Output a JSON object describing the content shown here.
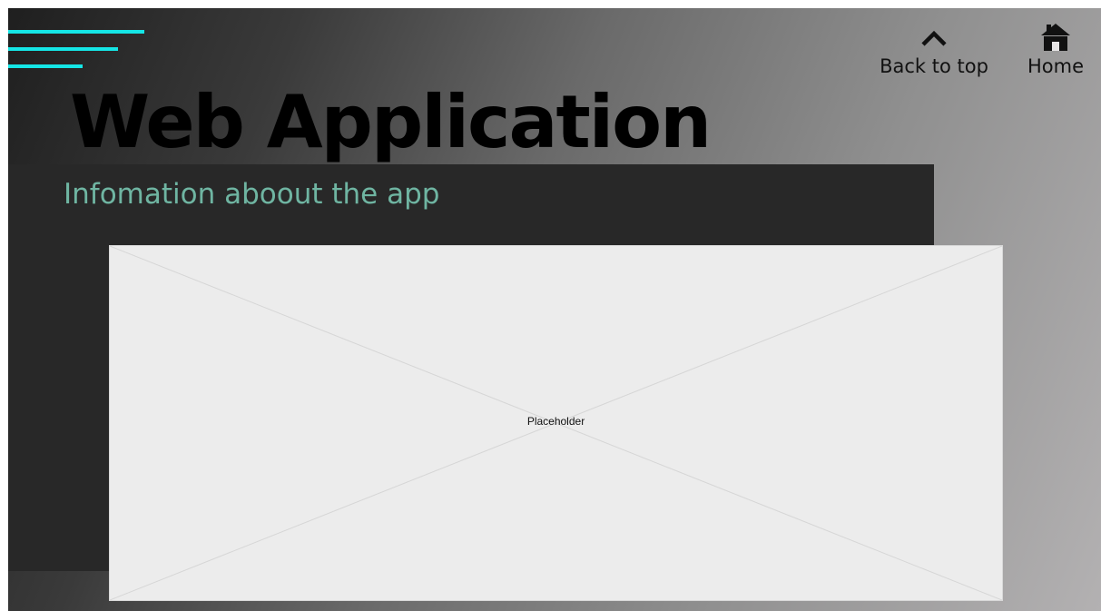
{
  "header": {
    "menu_icon": "hamburger-menu-icon",
    "accent_color": "#15e6e6"
  },
  "nav": {
    "back_to_top": {
      "label": "Back to top",
      "icon": "chevron-up-icon"
    },
    "home": {
      "label": "Home",
      "icon": "house-icon"
    }
  },
  "hero": {
    "title": "Web Application",
    "subtitle": "Infomation aboout the app",
    "subtitle_color": "#6fb5a2"
  },
  "media": {
    "placeholder_label": "Placeholder"
  }
}
